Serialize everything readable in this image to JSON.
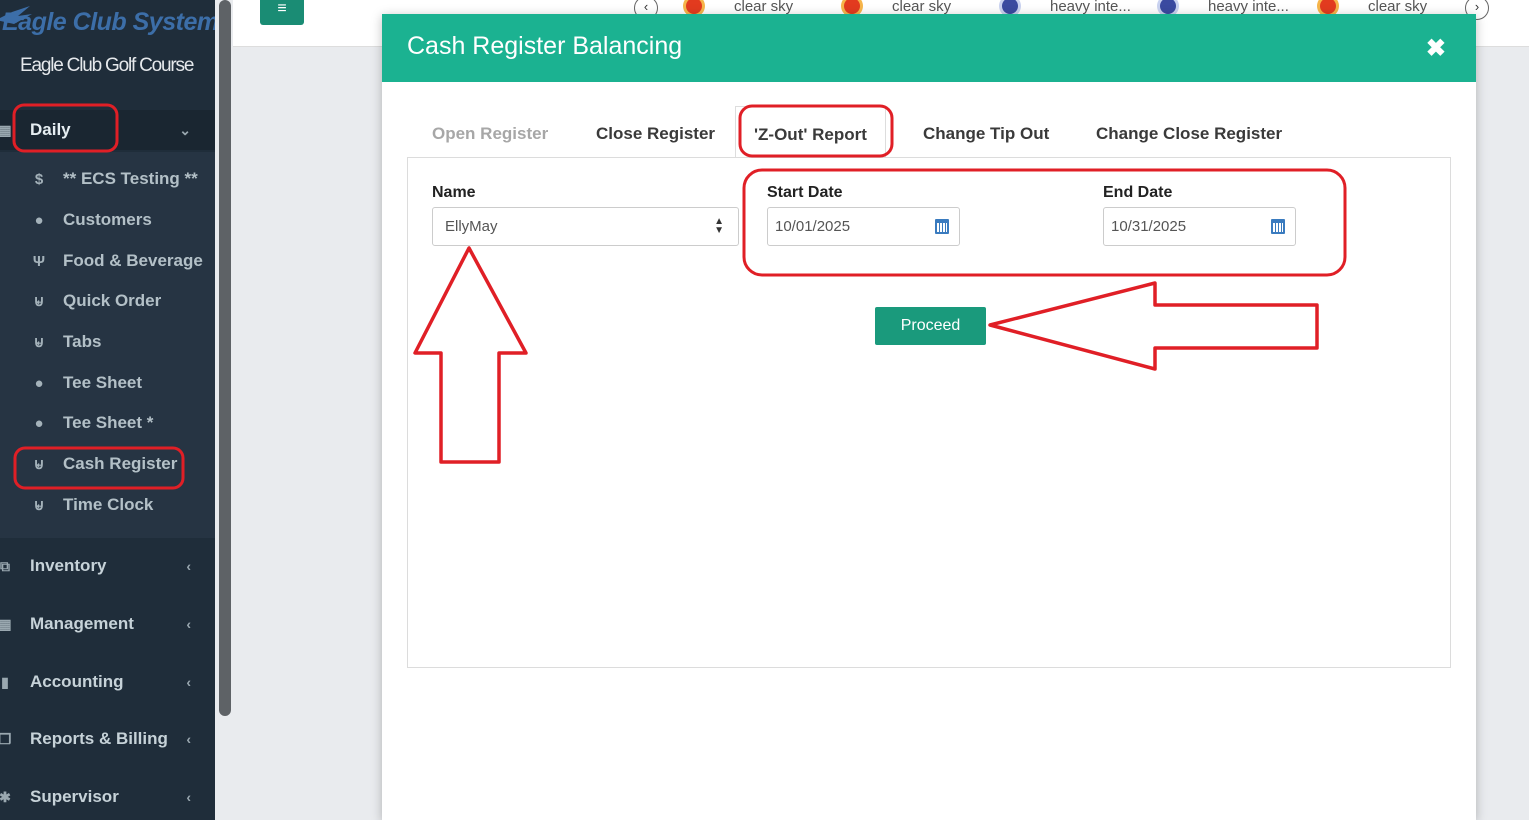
{
  "sidebar": {
    "brand": "Eagle Club Systems",
    "subtitle": "Eagle Club Golf Course",
    "groups": [
      {
        "label": "Daily",
        "icon": "calendar-icon",
        "chevron": "⌄"
      },
      {
        "label": "Inventory",
        "icon": "cubes-icon",
        "chevron": "‹"
      },
      {
        "label": "Management",
        "icon": "grid-icon",
        "chevron": "‹"
      },
      {
        "label": "Accounting",
        "icon": "bar-chart-icon",
        "chevron": "‹"
      },
      {
        "label": "Reports & Billing",
        "icon": "copy-icon",
        "chevron": "‹"
      },
      {
        "label": "Supervisor",
        "icon": "gear-icon",
        "chevron": "‹"
      }
    ],
    "daily_items": [
      {
        "label": "** ECS Testing **",
        "icon": "dollar-icon",
        "glyph": "$"
      },
      {
        "label": "Customers",
        "icon": "user-icon",
        "glyph": "●"
      },
      {
        "label": "Food & Beverage",
        "icon": "cutlery-icon",
        "glyph": "✖"
      },
      {
        "label": "Quick Order",
        "icon": "cart-icon",
        "glyph": "🛒"
      },
      {
        "label": "Tabs",
        "icon": "cart-icon",
        "glyph": "🛒"
      },
      {
        "label": "Tee Sheet",
        "icon": "golf-ball-icon",
        "glyph": "●"
      },
      {
        "label": "Tee Sheet *",
        "icon": "golf-ball-icon",
        "glyph": "●"
      },
      {
        "label": "Cash Register",
        "icon": "cart-icon",
        "glyph": "🛒"
      },
      {
        "label": "Time Clock",
        "icon": "cart-icon",
        "glyph": "🛒"
      }
    ]
  },
  "weather": [
    "clear sky",
    "clear sky",
    "heavy inte...",
    "heavy inte...",
    "clear sky"
  ],
  "modal": {
    "title": "Cash Register Balancing",
    "close": "✖",
    "tabs": [
      "Open Register",
      "Close Register",
      "'Z-Out' Report",
      "Change Tip Out",
      "Change Close Register"
    ],
    "name_label": "Name",
    "name_value": "EllyMay",
    "start_label": "Start Date",
    "start_value": "10/01/2025",
    "end_label": "End Date",
    "end_value": "10/31/2025",
    "proceed": "Proceed"
  },
  "colors": {
    "header": "#1bb291",
    "sidebar": "#1f2d3a",
    "button": "#1a9a7c",
    "annotation": "#e01f26"
  }
}
